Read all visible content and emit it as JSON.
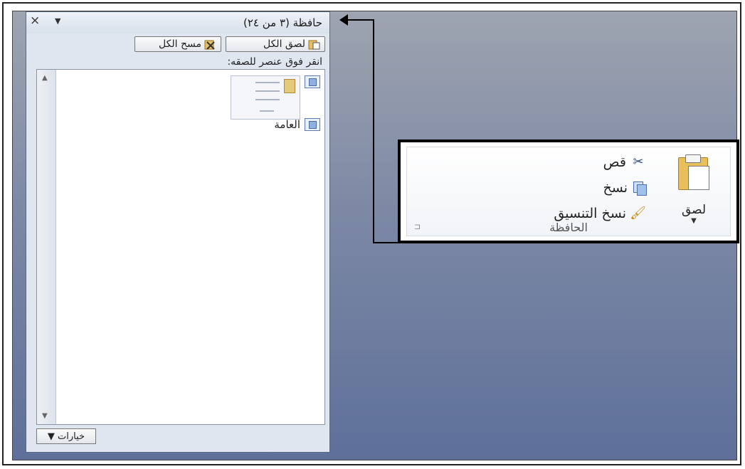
{
  "pane": {
    "title": "حافظة (٣ من ٢٤)",
    "close_glyph": "×",
    "menu_glyph": "▼",
    "paste_all_label": "لصق الكل",
    "clear_all_label": "مسح الكل",
    "hint": "انقر فوق عنصر للصقه:",
    "items": [
      {
        "label": ""
      },
      {
        "label": "العامة"
      }
    ],
    "options_label": "خيارات ▼"
  },
  "ribbon": {
    "paste_label": "لصق",
    "paste_arrow": "▼",
    "cut_label": "قص",
    "copy_label": "نسخ",
    "format_painter_label": "نسخ التنسيق",
    "group_label": "الحافظة",
    "launcher_glyph": "⊏"
  },
  "icons": {
    "paste_all": "paste-icon",
    "clear_all": "clear-icon",
    "cut": "scissors-icon",
    "copy": "copy-icon",
    "format_painter": "brush-icon",
    "paste": "clipboard-icon"
  }
}
